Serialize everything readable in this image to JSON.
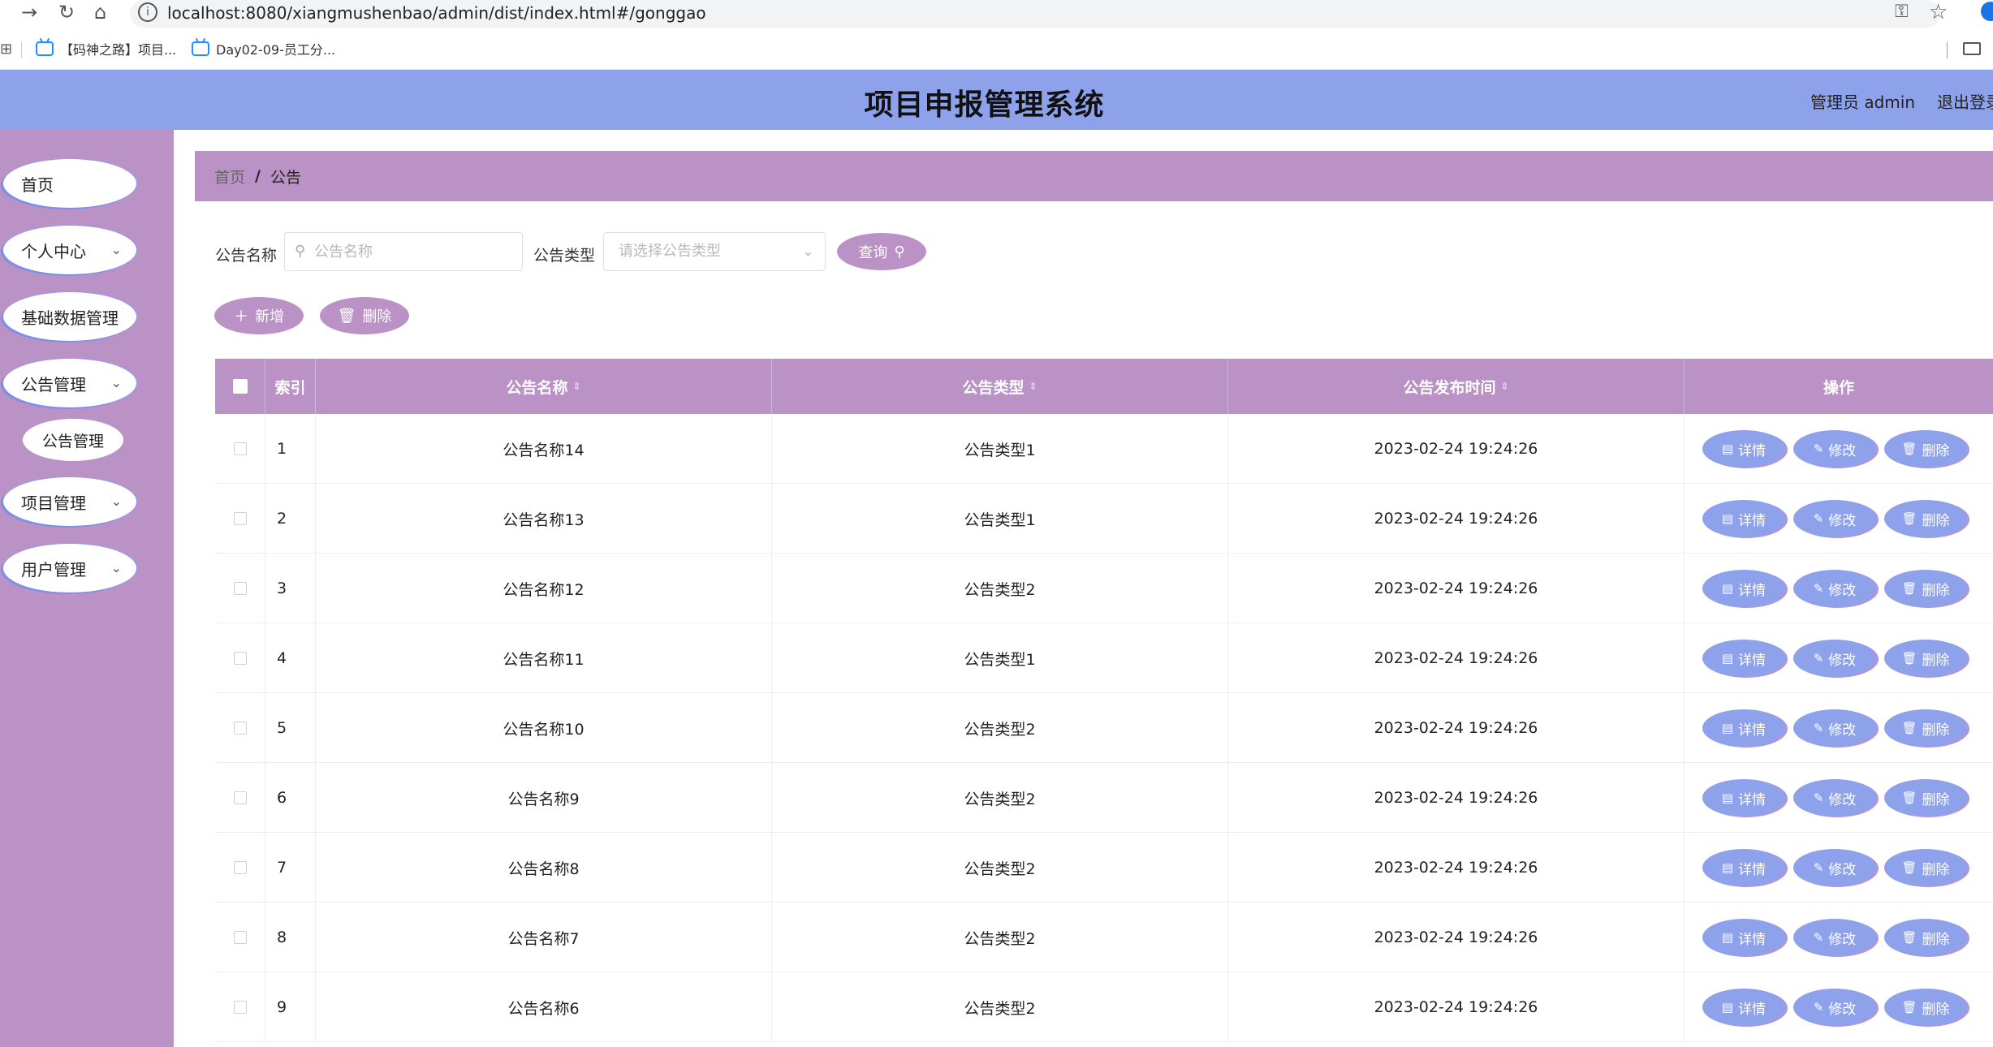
{
  "browser": {
    "url": "localhost:8080/xiangmushenbao/admin/dist/index.html#/gonggao",
    "bookmarks": [
      "【码神之路】项目...",
      "Day02-09-员工分..."
    ]
  },
  "header": {
    "title": "项目申报管理系统",
    "admin_label": "管理员 admin",
    "logout": "退出登录"
  },
  "sidebar": {
    "items": [
      {
        "label": "首页",
        "has_chevron": false
      },
      {
        "label": "个人中心",
        "has_chevron": true
      },
      {
        "label": "基础数据管理",
        "has_chevron": true
      },
      {
        "label": "公告管理",
        "has_chevron": true
      },
      {
        "label": "项目管理",
        "has_chevron": true
      },
      {
        "label": "用户管理",
        "has_chevron": true
      }
    ],
    "subitem": "公告管理"
  },
  "breadcrumb": {
    "home": "首页",
    "separator": "/",
    "current": "公告"
  },
  "search": {
    "name_label": "公告名称",
    "name_placeholder": "公告名称",
    "type_label": "公告类型",
    "type_placeholder": "请选择公告类型",
    "query_button": "查询"
  },
  "actions": {
    "add": "新增",
    "delete": "删除"
  },
  "table": {
    "columns": [
      "索引",
      "公告名称",
      "公告类型",
      "公告发布时间",
      "操作"
    ],
    "rows": [
      {
        "index": "1",
        "name": "公告名称14",
        "type": "公告类型1",
        "time": "2023-02-24 19:24:26"
      },
      {
        "index": "2",
        "name": "公告名称13",
        "type": "公告类型1",
        "time": "2023-02-24 19:24:26"
      },
      {
        "index": "3",
        "name": "公告名称12",
        "type": "公告类型2",
        "time": "2023-02-24 19:24:26"
      },
      {
        "index": "4",
        "name": "公告名称11",
        "type": "公告类型1",
        "time": "2023-02-24 19:24:26"
      },
      {
        "index": "5",
        "name": "公告名称10",
        "type": "公告类型2",
        "time": "2023-02-24 19:24:26"
      },
      {
        "index": "6",
        "name": "公告名称9",
        "type": "公告类型2",
        "time": "2023-02-24 19:24:26"
      },
      {
        "index": "7",
        "name": "公告名称8",
        "type": "公告类型2",
        "time": "2023-02-24 19:24:26"
      },
      {
        "index": "8",
        "name": "公告名称7",
        "type": "公告类型2",
        "time": "2023-02-24 19:24:26"
      },
      {
        "index": "9",
        "name": "公告名称6",
        "type": "公告类型2",
        "time": "2023-02-24 19:24:26"
      }
    ],
    "row_actions": {
      "detail": "详情",
      "edit": "修改",
      "delete": "删除"
    }
  },
  "colors": {
    "header_bg": "#8ea2ec",
    "sidebar_bg": "#bb92c6",
    "accent_purple": "#bb92c6",
    "op_button_bg": "#8ea2ec"
  }
}
